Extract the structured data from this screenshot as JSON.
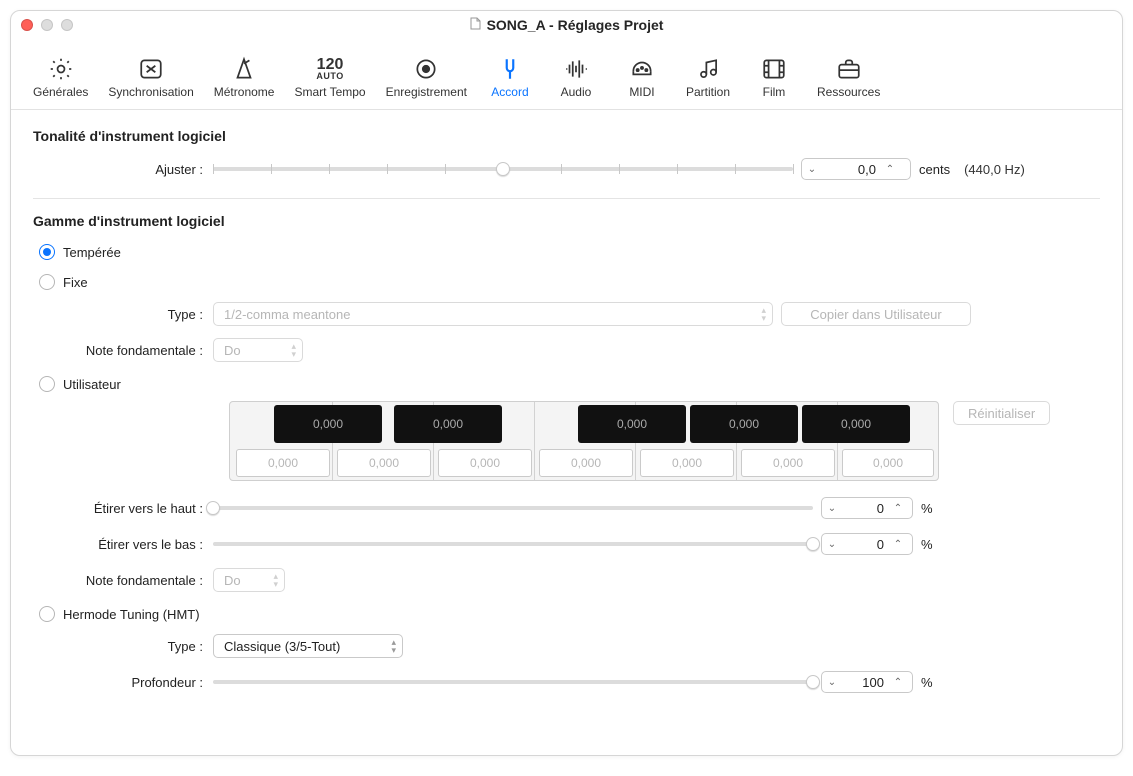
{
  "window": {
    "title": "SONG_A - Réglages Projet"
  },
  "toolbar": {
    "items": [
      {
        "id": "generales",
        "label": "Générales"
      },
      {
        "id": "synchronisation",
        "label": "Synchronisation"
      },
      {
        "id": "metronome",
        "label": "Métronome"
      },
      {
        "id": "smart-tempo",
        "label": "Smart Tempo"
      },
      {
        "id": "enregistrement",
        "label": "Enregistrement"
      },
      {
        "id": "accord",
        "label": "Accord"
      },
      {
        "id": "audio",
        "label": "Audio"
      },
      {
        "id": "midi",
        "label": "MIDI"
      },
      {
        "id": "partition",
        "label": "Partition"
      },
      {
        "id": "film",
        "label": "Film"
      },
      {
        "id": "ressources",
        "label": "Ressources"
      }
    ],
    "active_index": 5,
    "smart_tempo_bpm": "120",
    "smart_tempo_mode": "AUTO"
  },
  "tonalite": {
    "section_title": "Tonalité d'instrument logiciel",
    "ajuster_label": "Ajuster :",
    "ajuster_value": "0,0",
    "ajuster_unit": "cents",
    "ajuster_suffix": "(440,0 Hz)",
    "slider_pos_pct": 50
  },
  "gamme": {
    "section_title": "Gamme d'instrument logiciel",
    "temperee_label": "Tempérée",
    "fixe_label": "Fixe",
    "type_label": "Type :",
    "type_value": "1/2-comma meantone",
    "copy_button": "Copier dans Utilisateur",
    "root_label": "Note fondamentale :",
    "root_value": "Do",
    "utilisateur_label": "Utilisateur",
    "reset_button": "Réinitialiser",
    "black_values": [
      "0,000",
      "0,000",
      "0,000",
      "0,000",
      "0,000"
    ],
    "white_values": [
      "0,000",
      "0,000",
      "0,000",
      "0,000",
      "0,000",
      "0,000",
      "0,000"
    ],
    "stretch_up_label": "Étirer vers le haut :",
    "stretch_up_value": "0",
    "stretch_down_label": "Étirer vers le bas :",
    "stretch_down_value": "0",
    "root2_value": "Do",
    "hmt_label": "Hermode Tuning (HMT)",
    "hmt_type_value": "Classique (3/5-Tout)",
    "depth_label": "Profondeur :",
    "depth_value": "100",
    "pct": "%",
    "selected_radio": "temperee"
  }
}
